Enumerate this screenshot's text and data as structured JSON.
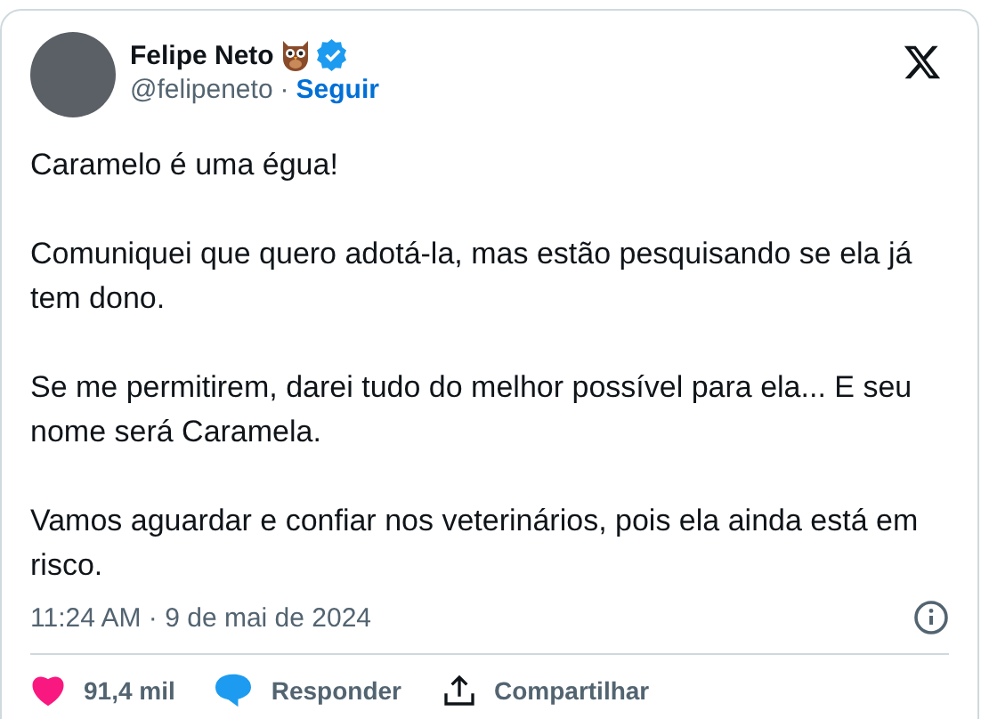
{
  "author": {
    "name": "Felipe Neto",
    "handle": "@felipeneto",
    "separator": "·",
    "follow": "Seguir"
  },
  "paragraphs": [
    "Caramelo é uma égua!",
    "Comuniquei que quero adotá-la, mas estão pesquisando se ela já tem dono.",
    "Se me permitirem, darei tudo do melhor possível para ela... E seu nome será Caramela.",
    "Vamos aguardar e confiar nos veterinários, pois ela ainda está em risco."
  ],
  "timestamp": "11:24 AM · 9 de mai de 2024",
  "actions": [
    {
      "kind": "like",
      "label": "91,4 mil"
    },
    {
      "kind": "reply",
      "label": "Responder"
    },
    {
      "kind": "share",
      "label": "Compartilhar"
    }
  ]
}
